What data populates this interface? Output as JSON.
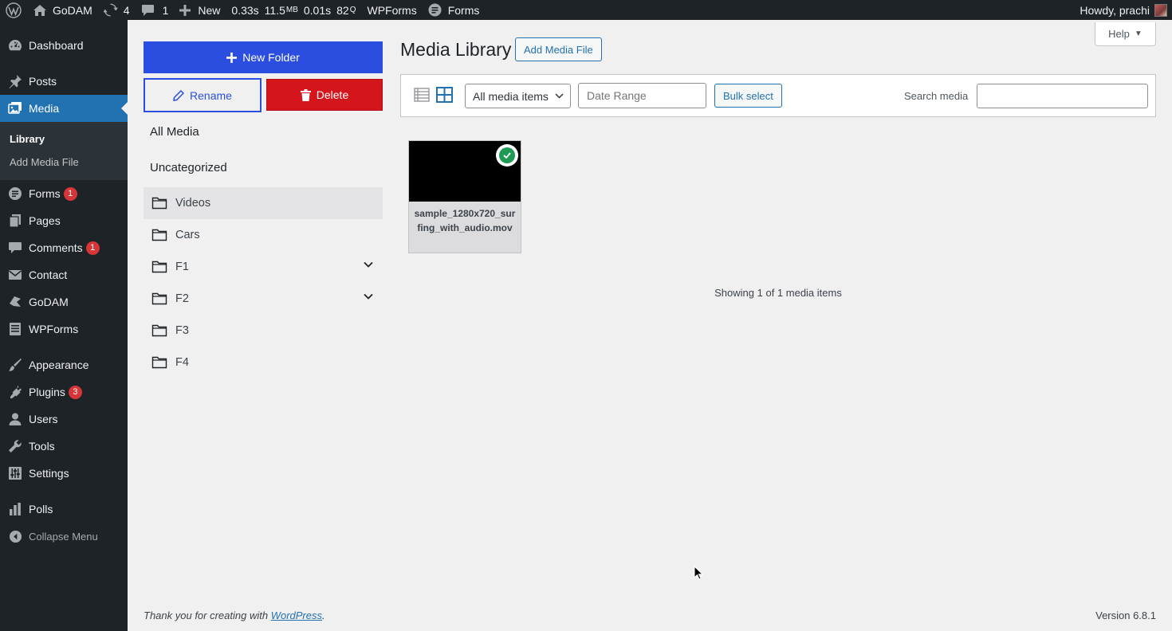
{
  "adminbar": {
    "site_name": "GoDAM",
    "updates_count": "4",
    "comments_count": "1",
    "new_label": "New",
    "perf_time": "0.33s",
    "perf_mem": "11.5",
    "perf_mem_unit": "MB",
    "perf_query_time": "0.01s",
    "perf_queries": "82",
    "perf_queries_unit": "Q",
    "wpforms_label": "WPForms",
    "forms_label": "Forms",
    "howdy": "Howdy, prachi"
  },
  "sidebar": {
    "dashboard": "Dashboard",
    "posts": "Posts",
    "media": "Media",
    "media_sub": {
      "library": "Library",
      "add_media_file": "Add Media File"
    },
    "forms": "Forms",
    "forms_badge": "1",
    "pages": "Pages",
    "comments": "Comments",
    "comments_badge": "1",
    "contact": "Contact",
    "godam": "GoDAM",
    "wpforms": "WPForms",
    "appearance": "Appearance",
    "plugins": "Plugins",
    "plugins_badge": "3",
    "users": "Users",
    "tools": "Tools",
    "settings": "Settings",
    "polls": "Polls",
    "collapse": "Collapse Menu"
  },
  "folders": {
    "new_folder": "New Folder",
    "rename": "Rename",
    "delete": "Delete",
    "all_media": "All Media",
    "uncategorized": "Uncategorized",
    "items": [
      {
        "name": "Videos"
      },
      {
        "name": "Cars"
      },
      {
        "name": "F1"
      },
      {
        "name": "F2"
      },
      {
        "name": "F3"
      },
      {
        "name": "F4"
      }
    ]
  },
  "main": {
    "title": "Media Library",
    "add_media_file": "Add Media File",
    "help": "Help",
    "filter_selected": "All media items",
    "date_range": "Date Range",
    "bulk_select": "Bulk select",
    "search_label": "Search media",
    "search_value": "",
    "attachment_name": "sample_1280x720_surfing_with_audio.mov",
    "showing": "Showing 1 of 1 media items"
  },
  "footer": {
    "thanks_prefix": "Thank you for creating with ",
    "thanks_link": "WordPress",
    "thanks_suffix": ".",
    "version": "Version 6.8.1"
  },
  "colors": {
    "admin_dark": "#1d2327",
    "wp_blue": "#2271b1",
    "new_folder_blue": "#2c4ee0",
    "delete_red": "#d4161c",
    "badge_red": "#d63638",
    "check_green": "#1e9a55"
  }
}
